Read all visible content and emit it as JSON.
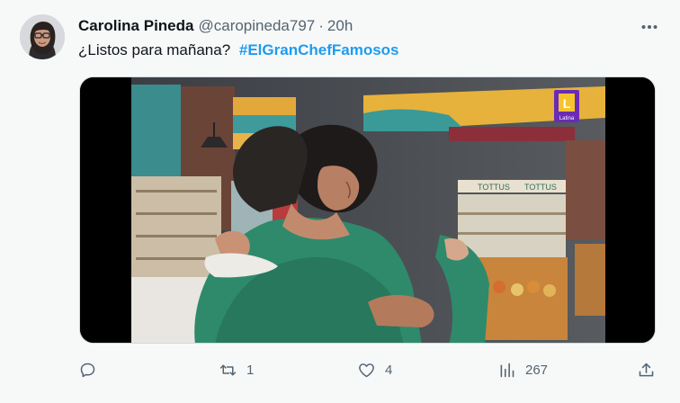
{
  "tweet": {
    "author_name": "Carolina Pineda",
    "author_handle": "@caropineda797",
    "separator": "·",
    "time": "20h",
    "text": "¿Listos para mañana?",
    "hashtag": "#ElGranChefFamosos"
  },
  "media": {
    "channel_logo_text": "Latina",
    "channel_logo_letter": "L",
    "sign_text": "TOTTUS"
  },
  "actions": {
    "reply_icon": "reply-icon",
    "retweet_icon": "retweet-icon",
    "retweet_count": "1",
    "like_icon": "heart-icon",
    "like_count": "4",
    "views_icon": "views-icon",
    "views_count": "267",
    "share_icon": "share-icon"
  },
  "colors": {
    "link": "#1d9bf0",
    "muted": "#536471",
    "text": "#0f1419"
  }
}
